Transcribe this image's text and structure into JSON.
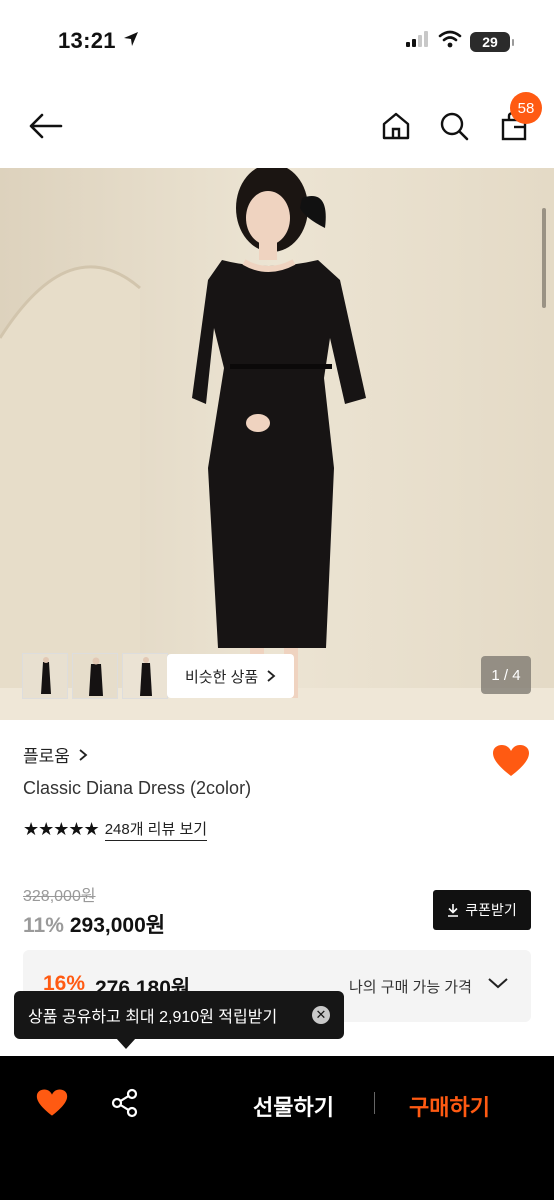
{
  "status_bar": {
    "time": "13:21",
    "battery": "29"
  },
  "nav": {
    "cart_count": "58"
  },
  "gallery": {
    "similar_label": "비슷한 상품",
    "counter": "1 / 4"
  },
  "product": {
    "brand": "플로움",
    "title": "Classic Diana Dress (2color)",
    "rating_stars": 5,
    "review_link": "248개 리뷰 보기",
    "original_price": "328,000원",
    "discount_rate": "11%",
    "sale_price": "293,000원",
    "coupon_label": "쿠폰받기",
    "my_discount_rate": "16%",
    "my_price": "276,180원",
    "my_price_label": "나의 구매 가능 가격"
  },
  "tooltip": {
    "text": "상품 공유하고 최대 2,910원 적립받기"
  },
  "bottom_bar": {
    "gift_label": "선물하기",
    "buy_label": "구매하기"
  },
  "colors": {
    "accent": "#ff5a12",
    "dark": "#111111"
  }
}
